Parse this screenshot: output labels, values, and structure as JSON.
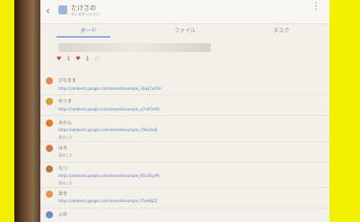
{
  "header": {
    "back_icon": "‹",
    "title": "たけさの",
    "subtitle": "ディスカッション",
    "more_icon": "⋮"
  },
  "tabs": [
    {
      "label": "ボード"
    },
    {
      "label": "ファイル"
    },
    {
      "label": "タスク"
    }
  ],
  "reactions": {
    "heart_count": "1",
    "like_count": "1"
  },
  "comments": [
    {
      "name": "ひなまま",
      "url": "https://ambient.google.com/shared/example_3DwJ7w1hU",
      "note": "",
      "avatar_color": "#e08b54"
    },
    {
      "name": "ゆうま",
      "url": "https://ambient.google.com/shared/example_q7mP2xK9",
      "note": "",
      "avatar_color": "#d4a13a"
    },
    {
      "name": "みかん",
      "url": "https://ambient.google.com/shared/example_rT8vL6nB",
      "note": "見ました",
      "avatar_color": "#e07b2c"
    },
    {
      "name": "はる",
      "url": "",
      "note": "見ました",
      "avatar_color": "#cf7a48"
    },
    {
      "name": "なつ",
      "url": "https://ambient.google.com/shared/example_W3cN1yP0",
      "note": "見ました",
      "avatar_color": "#b77a3f"
    },
    {
      "name": "あき",
      "url": "https://ambient.google.com/shared/example_F5aH8jZ2",
      "note": "",
      "avatar_color": "#e3935a"
    },
    {
      "name": "ふゆ",
      "url": "",
      "note": "",
      "avatar_color": "#6d88cf"
    }
  ]
}
